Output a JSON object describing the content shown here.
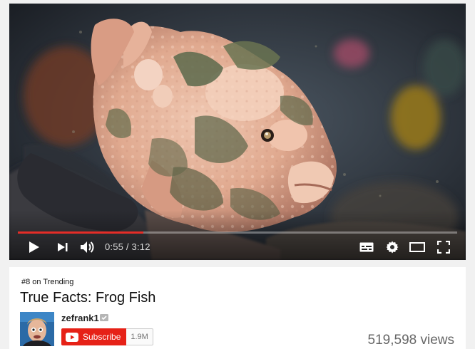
{
  "player": {
    "current_time": "0:55",
    "separator": " / ",
    "duration": "3:12",
    "progress_fraction": 0.2865
  },
  "video": {
    "trending_badge": "#8 on Trending",
    "title": "True Facts: Frog Fish",
    "views": "519,598 views"
  },
  "channel": {
    "name": "zefrank1",
    "subscribe_label": "Subscribe",
    "subscriber_count": "1.9M"
  },
  "icons": {
    "play": "play-icon",
    "next": "next-icon",
    "volume": "volume-icon",
    "captions": "captions-icon",
    "settings": "gear-icon",
    "theater": "theater-mode-icon",
    "fullscreen": "fullscreen-icon",
    "verified": "verified-icon",
    "youtube": "youtube-logo-icon"
  },
  "colors": {
    "progress": "#e52d27",
    "subscribe": "#e62117"
  }
}
